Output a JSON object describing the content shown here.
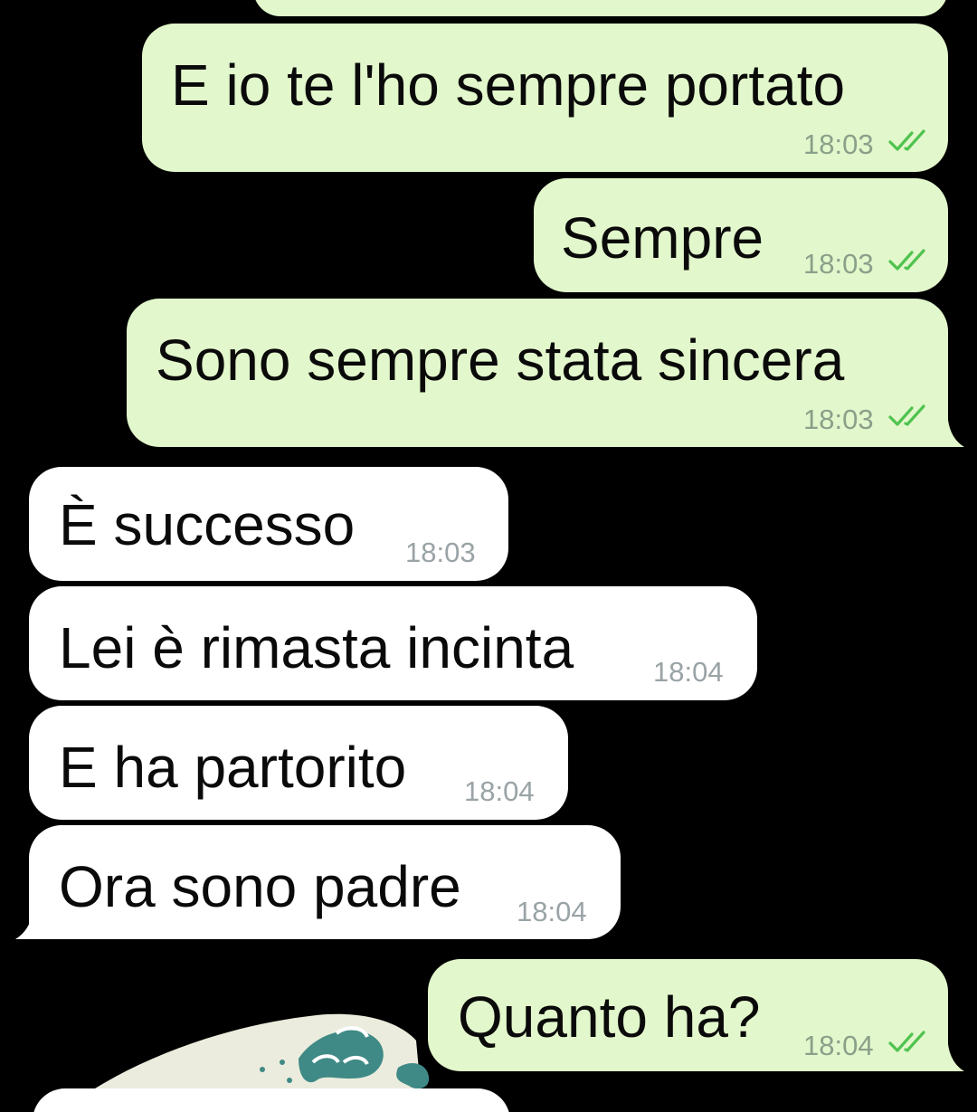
{
  "chat": {
    "messages": [
      {
        "id": "m1",
        "direction": "outgoing",
        "text": "E io te l'ho sempre portato",
        "time": "18:03",
        "status": "read-double-check-icon"
      },
      {
        "id": "m2",
        "direction": "outgoing",
        "text": "Sempre",
        "time": "18:03",
        "status": "read-double-check-icon"
      },
      {
        "id": "m3",
        "direction": "outgoing",
        "text": "Sono sempre stata sincera",
        "time": "18:03",
        "status": "read-double-check-icon"
      },
      {
        "id": "m4",
        "direction": "incoming",
        "text": "È successo",
        "time": "18:03"
      },
      {
        "id": "m5",
        "direction": "incoming",
        "text": "Lei è rimasta incinta",
        "time": "18:04"
      },
      {
        "id": "m6",
        "direction": "incoming",
        "text": "E ha partorito",
        "time": "18:04"
      },
      {
        "id": "m7",
        "direction": "incoming",
        "text": "Ora sono padre",
        "time": "18:04"
      },
      {
        "id": "m8",
        "direction": "outgoing",
        "text": "Quanto ha?",
        "time": "18:04",
        "status": "read-double-check-icon"
      }
    ]
  },
  "colors": {
    "background": "#000000",
    "outgoing_bubble": "#e2f7cb",
    "incoming_bubble": "#ffffff",
    "read_ticks": "#4fc34f"
  }
}
